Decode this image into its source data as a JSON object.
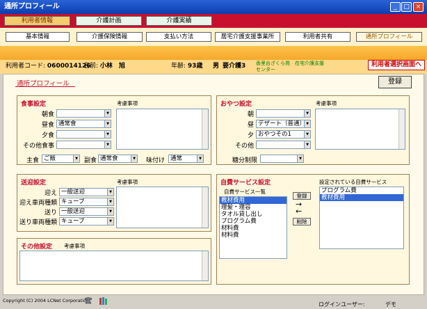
{
  "window": {
    "title": "通所プロフィール",
    "min": "_",
    "max": "□",
    "close": "×"
  },
  "main_tabs": [
    "利用者情報",
    "介護計画",
    "介護実績"
  ],
  "sub_tabs": [
    "基本情報",
    "介護保険情報",
    "支払い方法",
    "居宅介護支援事業所",
    "利用者共有",
    "通所プロフィール"
  ],
  "info": {
    "code_label": "利用者コード:",
    "code": "0600014126",
    "name_label": "名前:",
    "name": "小林　旭",
    "age_label": "年齢:",
    "age": "93歳",
    "gender": "男",
    "care_level": "要介護3",
    "office": "香里台ざくら苑　在宅介護支援センター",
    "back_button": "利用者選択画面へ"
  },
  "page_title": "通所プロフィール",
  "save_button": "登録",
  "meal": {
    "title": "食事設定",
    "notes_label": "考慮事項",
    "rows": [
      {
        "label": "朝食",
        "value": ""
      },
      {
        "label": "昼食",
        "value": "通常食"
      },
      {
        "label": "夕食",
        "value": ""
      },
      {
        "label": "その他食事",
        "value": ""
      }
    ],
    "staple_label": "主食",
    "staple": "ご飯",
    "side_label": "副食",
    "side": "通常食",
    "flavor_label": "味付け",
    "flavor": "通常"
  },
  "snack": {
    "title": "おやつ設定",
    "notes_label": "考慮事項",
    "rows": [
      {
        "label": "朝",
        "value": ""
      },
      {
        "label": "昼",
        "value": "デザート（普通）"
      },
      {
        "label": "夕",
        "value": "おやつその1"
      },
      {
        "label": "その他",
        "value": ""
      }
    ],
    "sugar_label": "糖分制限",
    "sugar": ""
  },
  "transport": {
    "title": "送迎設定",
    "notes_label": "考慮事項",
    "rows": [
      {
        "label": "迎え",
        "value": "一般送迎"
      },
      {
        "label": "迎え車両種類",
        "value": "キューブ"
      },
      {
        "label": "送り",
        "value": "一般送迎"
      },
      {
        "label": "送り車両種類",
        "value": "キューブ"
      }
    ]
  },
  "other": {
    "title": "その他設定",
    "notes_label": "考慮事項"
  },
  "self_pay": {
    "title": "自費サービス設定",
    "list_label": "自費サービス一覧",
    "list": [
      "教材費用",
      "理髪・理容",
      "タオル貸し出し",
      "プログラム費",
      "材料費",
      "材料費"
    ],
    "selected_label": "設定されている自費サービス",
    "selected": [
      "プログラム費",
      "教材費用"
    ],
    "register_button": "登録",
    "delete_button": "削除",
    "arrow_right": "→",
    "arrow_left": "←"
  },
  "footer": {
    "copyright": "Copyright (C) 2004 LCNet Corporation",
    "login_label": "ログインユーザー:",
    "login_user": "デモ"
  }
}
